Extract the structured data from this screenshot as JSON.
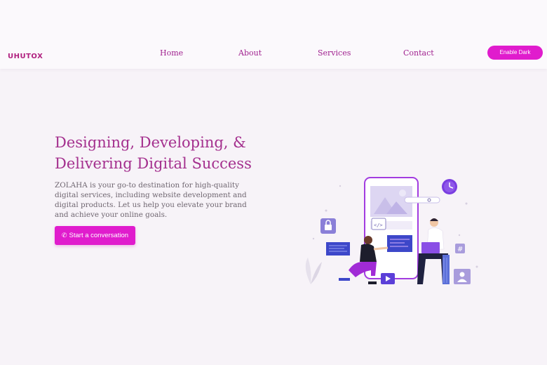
{
  "header": {
    "logo_text": "UHUTOX",
    "nav": [
      {
        "label": "Home"
      },
      {
        "label": "About"
      },
      {
        "label": "Services"
      },
      {
        "label": "Contact"
      }
    ],
    "dark_mode_button": "Enable Dark"
  },
  "hero": {
    "title_line1": "Designing, Developing, &",
    "title_line2": "Delivering Digital Success",
    "description": "ZOLAHA is your go-to destination for high-quality digital services, including website development and digital products. Let us help you elevate your brand and achieve your online goals.",
    "cta_label": "Start a conversation",
    "cta_icon": "whatsapp-icon"
  },
  "colors": {
    "accent": "#e01ccd",
    "title": "#a4308e",
    "nav": "#a0218f",
    "background": "#f7f3f8"
  }
}
